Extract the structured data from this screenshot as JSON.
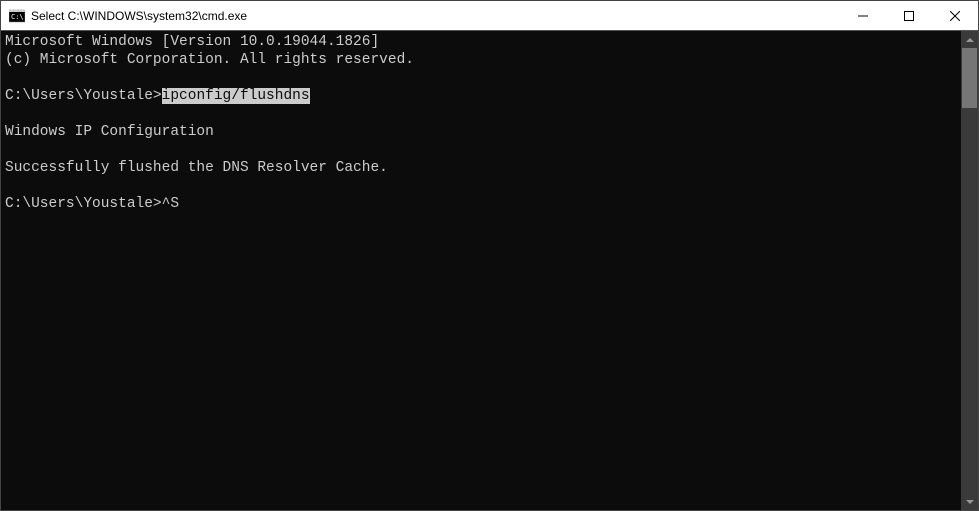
{
  "titlebar": {
    "title": "Select C:\\WINDOWS\\system32\\cmd.exe"
  },
  "terminal": {
    "line1": "Microsoft Windows [Version 10.0.19044.1826]",
    "line2": "(c) Microsoft Corporation. All rights reserved.",
    "prompt1_prefix": "C:\\Users\\Youstale>",
    "prompt1_command": "ipconfig/flushdns",
    "output_header": "Windows IP Configuration",
    "output_result": "Successfully flushed the DNS Resolver Cache.",
    "prompt2_prefix": "C:\\Users\\Youstale>",
    "prompt2_input": "^S"
  }
}
